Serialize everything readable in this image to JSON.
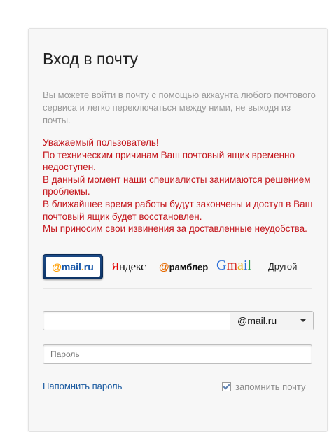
{
  "title": "Вход в почту",
  "intro": "Вы можете войти в почту с помощью аккаунта любого почтового сервиса и легко переключаться между ними, не выходя из почты.",
  "warning": "Уважаемый пользователь!\nПо техническим причинам Ваш почтовый ящик временно недоступен.\nВ данный момент наши специалисты занимаются решением проблемы.\nВ ближайшее время работы будут закончены и доступ в Ваш почтовый ящик будет восстановлен.\nМы приносим свои извинения за доставленные неудобства.",
  "providers": {
    "mailru": {
      "at": "@",
      "mail": "mail",
      "dot": ".",
      "ru": "ru"
    },
    "yandex": {
      "first": "Я",
      "rest": "ндекс"
    },
    "rambler": {
      "symbol": "@",
      "text": "рамблер"
    },
    "gmail": {
      "g": "G",
      "m": "m",
      "a": "a",
      "i": "i",
      "l": "l"
    },
    "other": "Другой"
  },
  "login": {
    "value": "",
    "domain": "@mail.ru"
  },
  "password": {
    "placeholder": "Пароль"
  },
  "remind_link": "Напомнить пароль",
  "remember": {
    "label": "запомнить почту",
    "checked": true
  },
  "colors": {
    "warning": "#c4161c",
    "link": "#1a5aa0",
    "intro": "#9a9a9a",
    "mailru_orange": "#ff9e00",
    "mailru_blue": "#1a58a8"
  }
}
